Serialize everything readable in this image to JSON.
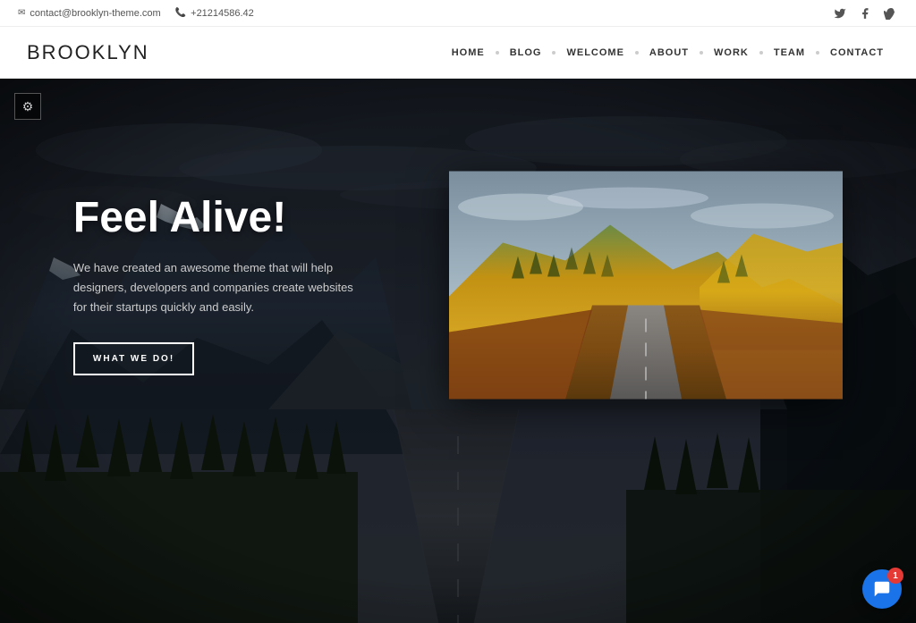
{
  "topbar": {
    "email": "contact@brooklyn-theme.com",
    "phone": "+21214586.42",
    "email_icon": "✉",
    "phone_icon": "📞"
  },
  "social": {
    "twitter": "𝕏",
    "facebook": "f",
    "vimeo": "▶"
  },
  "header": {
    "logo_part1": "BROOK",
    "logo_part2": "LYN",
    "nav_items": [
      "HOME",
      "BLOG",
      "WELCOME",
      "ABOUT",
      "WORK",
      "TEAM",
      "CONTACT"
    ]
  },
  "hero": {
    "title": "Feel Alive!",
    "subtitle": "We have created an awesome theme that will help designers, developers and companies create websites for their startups quickly and easily.",
    "cta_label": "WHAT WE DO!",
    "gear_icon": "⚙"
  },
  "chat": {
    "icon": "💬",
    "badge": "1"
  }
}
